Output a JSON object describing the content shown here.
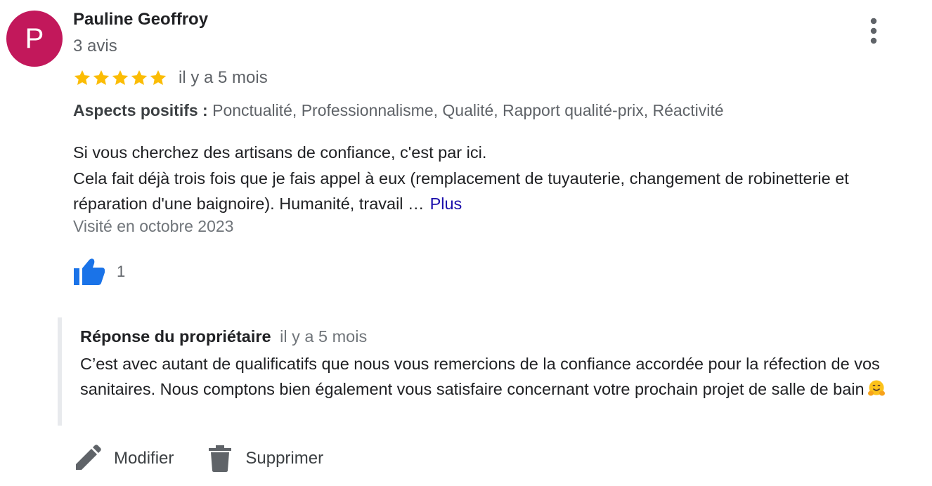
{
  "review": {
    "avatar_letter": "P",
    "avatar_color": "#c2185b",
    "author": "Pauline Geoffroy",
    "review_count": "3 avis",
    "rating": 5,
    "rating_max": 5,
    "time": "il y a 5 mois",
    "aspects": {
      "label": "Aspects positifs :",
      "values": "Ponctualité, Professionnalisme, Qualité, Rapport qualité-prix, Réactivité"
    },
    "text_line1": "Si vous cherchez des artisans de confiance, c'est par ici.",
    "text_line2": "Cela fait déjà trois fois que je fais appel à eux (remplacement de tuyauterie, changement de robinetterie et réparation d'une baignoire). Humanité, travail …",
    "more_label": "Plus",
    "visited": "Visité en octobre 2023",
    "likes": "1"
  },
  "owner_reply": {
    "title": "Réponse du propriétaire",
    "time": "il y a 5 mois",
    "text": "C’est avec autant de qualificatifs que nous vous remercions de la confiance accordée pour la réfection de vos sanitaires. Nous comptons bien également vous satisfaire concernant votre prochain projet de salle de bain"
  },
  "actions": {
    "edit_label": "Modifier",
    "delete_label": "Supprimer"
  },
  "icons": {
    "menu": "more-vert-icon",
    "star": "star-icon",
    "like": "thumb-up-icon",
    "emoji": "hugging-face-emoji",
    "edit": "pencil-icon",
    "delete": "trash-icon"
  },
  "colors": {
    "star": "#fbbc04",
    "link": "#1a0dab",
    "like": "#1a73e8",
    "reply_border": "#e8eaed"
  }
}
